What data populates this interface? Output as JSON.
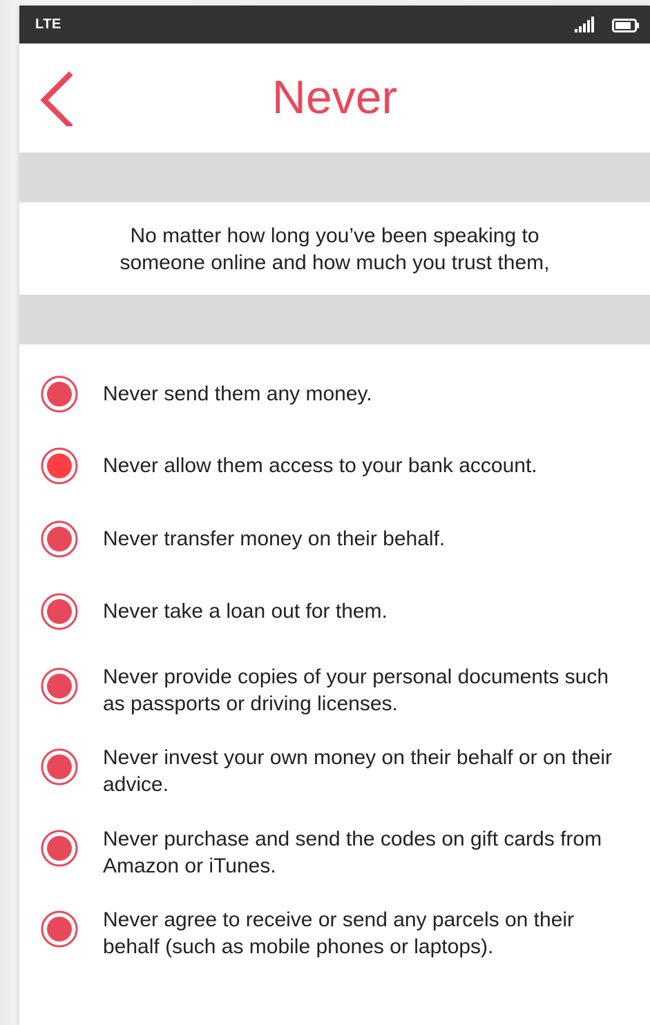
{
  "status_bar": {
    "network": "LTE",
    "signal_icon": "signal-bars-icon",
    "battery_icon": "battery-icon"
  },
  "header": {
    "title": "Never",
    "back_icon": "chevron-left-icon"
  },
  "intro": {
    "text": "No matter how long you’ve been speaking to someone online and how much you trust them,"
  },
  "list": {
    "bullet_icon": "radio-dot-icon",
    "items": [
      {
        "text": "Never send them any money."
      },
      {
        "text": "Never allow them access to your bank account."
      },
      {
        "text": "Never transfer money on their behalf."
      },
      {
        "text": "Never take a loan out for them."
      },
      {
        "text": "Never provide copies of your personal documents such as passports or driving licenses."
      },
      {
        "text": "Never invest your own money on their behalf or on their advice."
      },
      {
        "text": "Never purchase and send the codes on gift cards from Amazon or iTunes."
      },
      {
        "text": "Never agree to receive or send any parcels on their behalf (such as mobile phones or laptops)."
      }
    ]
  },
  "colors": {
    "accent": "#e8495a",
    "status_bar": "#333333",
    "band": "#d9dadc",
    "text": "#222222"
  }
}
